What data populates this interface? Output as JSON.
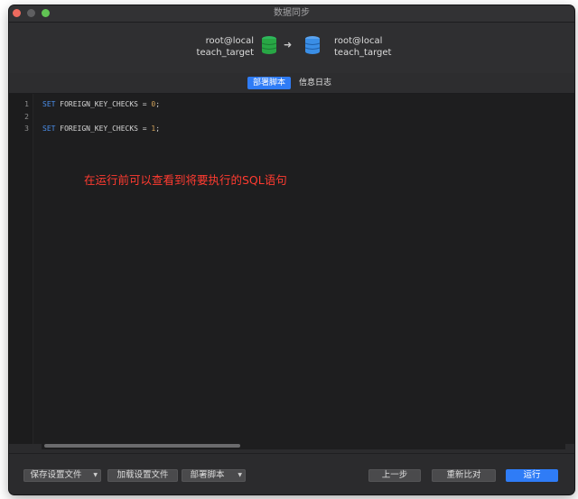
{
  "window": {
    "title": "数据同步"
  },
  "source": {
    "user": "root@local",
    "database": "teach_target",
    "icon": "database-green-icon",
    "color": "#28a745"
  },
  "target": {
    "user": "root@local",
    "database": "teach_target",
    "icon": "database-blue-icon",
    "color": "#3a8ee6"
  },
  "arrow": "➜",
  "tabs": [
    {
      "label": "部署脚本",
      "active": true
    },
    {
      "label": "信息日志",
      "active": false
    }
  ],
  "editor": {
    "lines": [
      {
        "number": "1",
        "keyword": "SET",
        "text": " FOREIGN_KEY_CHECKS = ",
        "value": "0",
        "end": ";"
      },
      {
        "number": "2",
        "keyword": "",
        "text": "",
        "value": "",
        "end": ""
      },
      {
        "number": "3",
        "keyword": "SET",
        "text": " FOREIGN_KEY_CHECKS = ",
        "value": "1",
        "end": ";"
      }
    ]
  },
  "annotation": "在运行前可以查看到将要执行的SQL语句",
  "footer": {
    "save_settings": "保存设置文件",
    "load_settings": "加载设置文件",
    "deploy_script": "部署脚本",
    "previous": "上一步",
    "recompare": "重新比对",
    "run": "运行"
  },
  "colors": {
    "accent": "#2f7cf6",
    "annotation": "#ff3b30"
  }
}
